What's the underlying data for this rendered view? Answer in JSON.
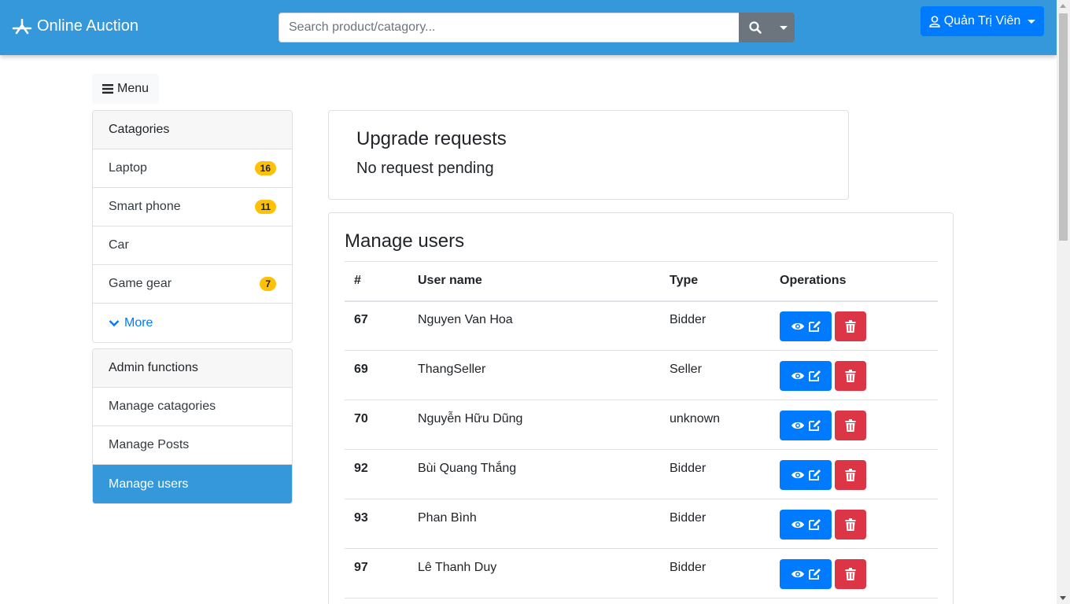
{
  "navbar": {
    "brand": "Online Auction",
    "search_placeholder": "Search product/catagory...",
    "user_label": "Quản Trị Viên"
  },
  "menu_button": {
    "label": "Menu"
  },
  "categories": {
    "header": "Catagories",
    "items": [
      {
        "label": "Laptop",
        "count": "16"
      },
      {
        "label": "Smart phone",
        "count": "11"
      },
      {
        "label": "Car",
        "count": ""
      },
      {
        "label": "Game gear",
        "count": "7"
      }
    ],
    "more_label": "More"
  },
  "admin": {
    "header": "Admin functions",
    "items": [
      {
        "label": "Manage catagories",
        "active": false
      },
      {
        "label": "Manage Posts",
        "active": false
      },
      {
        "label": "Manage users",
        "active": true
      }
    ]
  },
  "upgrade": {
    "title": "Upgrade requests",
    "status": "No request pending"
  },
  "users": {
    "title": "Manage users",
    "columns": [
      "#",
      "User name",
      "Type",
      "Operations"
    ],
    "rows": [
      {
        "id": "67",
        "name": "Nguyen Van Hoa",
        "type": "Bidder"
      },
      {
        "id": "69",
        "name": "ThangSeller",
        "type": "Seller"
      },
      {
        "id": "70",
        "name": "Nguyễn Hữu Dũng",
        "type": "unknown"
      },
      {
        "id": "92",
        "name": "Bùi Quang Thắng",
        "type": "Bidder"
      },
      {
        "id": "93",
        "name": "Phan Bình",
        "type": "Bidder"
      },
      {
        "id": "97",
        "name": "Lê Thanh Duy",
        "type": "Bidder"
      }
    ]
  },
  "colors": {
    "navbar": "#3498db",
    "primary": "#007bff",
    "danger": "#dc3545",
    "badge": "#ffc107",
    "active_item": "#3498db"
  }
}
